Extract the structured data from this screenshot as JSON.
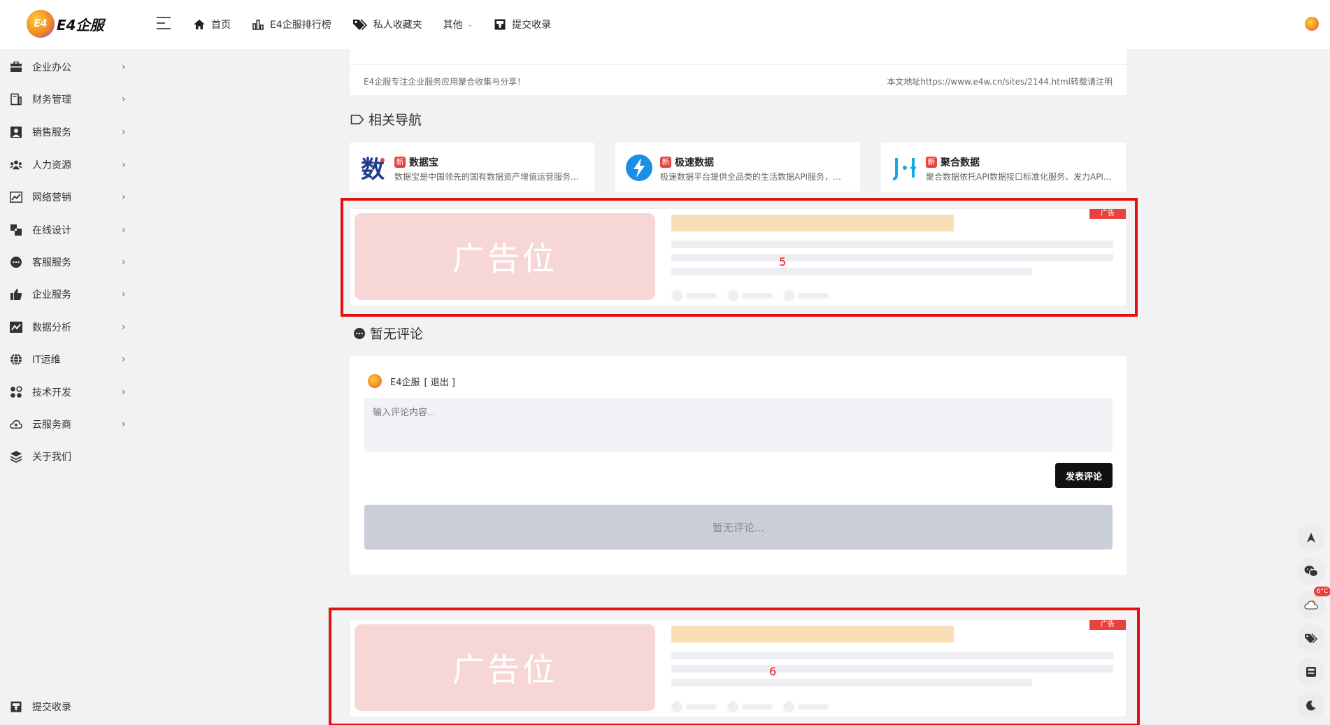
{
  "header": {
    "logo_badge": "E4",
    "logo_text": "E4企服",
    "nav": [
      {
        "label": "首页",
        "icon": "home-icon"
      },
      {
        "label": "E4企服排行榜",
        "icon": "bar-chart-icon"
      },
      {
        "label": "私人收藏夹",
        "icon": "tags-icon"
      },
      {
        "label": "其他",
        "icon": "chevron-down-icon"
      },
      {
        "label": "提交收录",
        "icon": "archive-icon"
      }
    ]
  },
  "sidebar": {
    "items": [
      {
        "label": "企业办公",
        "icon": "briefcase-icon"
      },
      {
        "label": "财务管理",
        "icon": "finance-icon"
      },
      {
        "label": "销售服务",
        "icon": "sales-icon"
      },
      {
        "label": "人力资源",
        "icon": "people-icon"
      },
      {
        "label": "网络营销",
        "icon": "trend-icon"
      },
      {
        "label": "在线设计",
        "icon": "design-icon"
      },
      {
        "label": "客服服务",
        "icon": "chat-icon"
      },
      {
        "label": "企业服务",
        "icon": "thumbs-up-icon"
      },
      {
        "label": "数据分析",
        "icon": "analytics-icon"
      },
      {
        "label": "IT运维",
        "icon": "globe-icon"
      },
      {
        "label": "技术开发",
        "icon": "dev-icon"
      },
      {
        "label": "云服务商",
        "icon": "cloud-icon"
      },
      {
        "label": "关于我们",
        "icon": "layers-icon"
      }
    ],
    "bottom_item": {
      "label": "提交收录",
      "icon": "archive-icon"
    }
  },
  "article_footer": {
    "left": "E4企服专注企业服务应用聚合收集与分享！",
    "right": "本文地址https://www.e4w.cn/sites/2144.html转载请注明"
  },
  "related": {
    "title": "相关导航",
    "items": [
      {
        "tag": "新",
        "name": "数据宝",
        "desc": "数据宝是中国领先的国有数据资产增值运营服务..."
      },
      {
        "tag": "新",
        "name": "极速数据",
        "desc": "极速数据平台提供全品类的生活数据API服务，方..."
      },
      {
        "tag": "新",
        "name": "聚合数据",
        "desc": "聚合数据依托API数据接口标准化服务、发力API..."
      }
    ]
  },
  "ads": [
    {
      "image_text": "广告位",
      "tag": "广告",
      "number": "5"
    },
    {
      "image_text": "广告位",
      "tag": "广告",
      "number": "6"
    }
  ],
  "comments": {
    "title": "暂无评论",
    "user": "E4企服",
    "logout": "[ 退出 ]",
    "placeholder": "输入评论内容...",
    "submit": "发表评论",
    "empty": "暂无评论..."
  },
  "tools": {
    "weather_badge": "6°C"
  },
  "colors": {
    "highlight": "#e3100f",
    "tag_red": "#e8423e",
    "ad_image": "#f7d6d6",
    "ad_title_bar": "#f9dfb6",
    "submit_bg": "#111111"
  }
}
